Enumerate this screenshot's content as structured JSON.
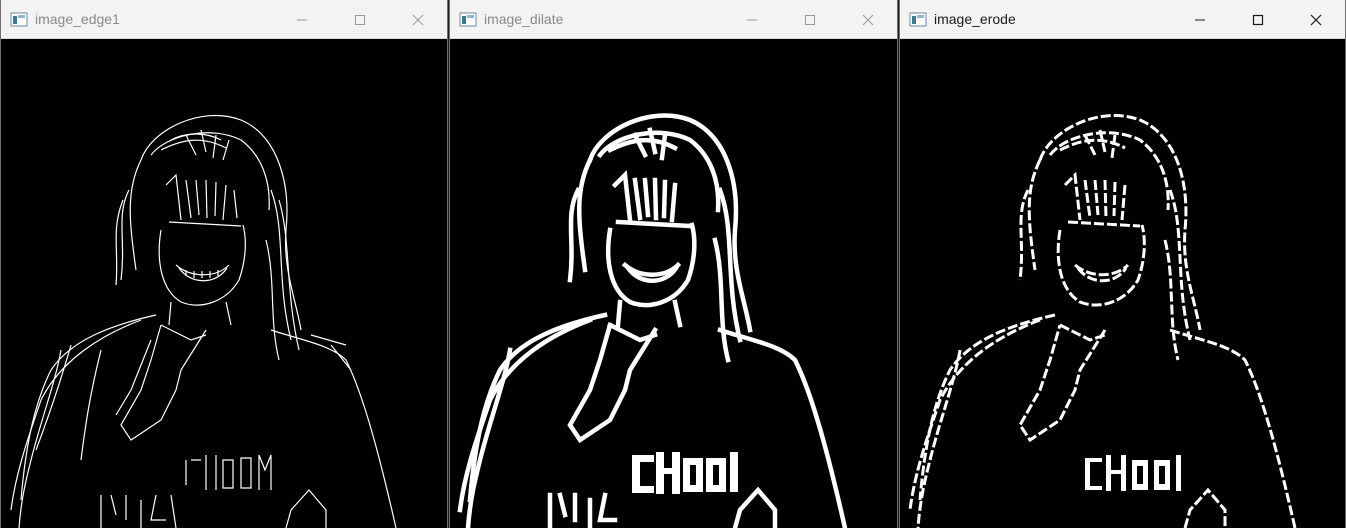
{
  "windows": [
    {
      "title": "image_edge1",
      "active": false
    },
    {
      "title": "image_dilate",
      "active": false
    },
    {
      "title": "image_erode",
      "active": true
    }
  ],
  "image_text": "CHOOM",
  "colors": {
    "titlebar": "#f3f3f3",
    "inactive_title": "#8a8a8a",
    "active_title": "#1a1a1a",
    "canvas": "#000000",
    "edges": "#ffffff"
  },
  "icons": {
    "app": "image-window-icon",
    "minimize": "minimize-icon",
    "maximize": "maximize-icon",
    "close": "close-icon"
  }
}
